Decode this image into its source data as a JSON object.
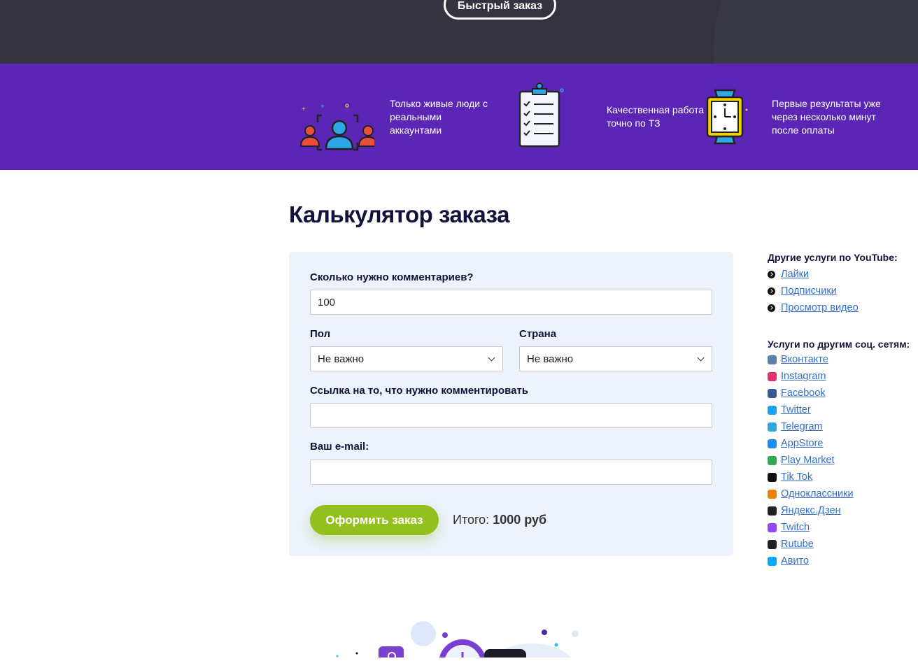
{
  "hero": {
    "quick_order_label": "Быстрый заказ"
  },
  "features": [
    {
      "icon": "people-icon",
      "text": "Только живые люди с реальными аккаунтами"
    },
    {
      "icon": "checklist-icon",
      "text": "Качественная работа точно по ТЗ"
    },
    {
      "icon": "watch-icon",
      "text": "Первые результаты уже через несколько минут после оплаты"
    }
  ],
  "calculator": {
    "title": "Калькулятор заказа",
    "count_label": "Сколько нужно комментариев?",
    "count_value": "100",
    "gender_label": "Пол",
    "gender_value": "Не важно",
    "country_label": "Страна",
    "country_value": "Не важно",
    "link_label": "Ссылка на то, что нужно комментировать",
    "link_value": "",
    "email_label": "Ваш e-mail:",
    "email_value": "",
    "order_button": "Оформить заказ",
    "total_label": "Итого:",
    "total_value": "1000 руб"
  },
  "sidebar": {
    "youtube_heading": "Другие услуги по YouTube:",
    "youtube_items": [
      "Лайки",
      "Подписчики",
      "Просмотр видео"
    ],
    "social_heading": "Услуги по другим соц. сетям:",
    "social_items": [
      {
        "label": "Вконтакте",
        "icon": "vk-icon",
        "color": "#5b7fa6"
      },
      {
        "label": "Instagram",
        "icon": "instagram-icon",
        "color": "#e1306c"
      },
      {
        "label": "Facebook",
        "icon": "facebook-icon",
        "color": "#3b5998"
      },
      {
        "label": "Twitter",
        "icon": "twitter-icon",
        "color": "#1da1f2"
      },
      {
        "label": "Telegram",
        "icon": "telegram-icon",
        "color": "#2ca5e0"
      },
      {
        "label": "AppStore",
        "icon": "appstore-icon",
        "color": "#1d8cf0"
      },
      {
        "label": "Play Market",
        "icon": "playmarket-icon",
        "color": "#34a853"
      },
      {
        "label": "Tik Tok",
        "icon": "tiktok-icon",
        "color": "#111111"
      },
      {
        "label": "Одноклассники",
        "icon": "ok-icon",
        "color": "#ee8208"
      },
      {
        "label": "Яндекс.Дзен",
        "icon": "zen-icon",
        "color": "#222222"
      },
      {
        "label": "Twitch",
        "icon": "twitch-icon",
        "color": "#9146ff"
      },
      {
        "label": "Rutube",
        "icon": "rutube-icon",
        "color": "#222222"
      },
      {
        "label": "Авито",
        "icon": "avito-icon",
        "color": "#00aaff"
      }
    ]
  },
  "colors": {
    "hero_bg": "#34333f",
    "features_bg": "#5b25b5",
    "accent_green": "#93c01f",
    "link": "#3470c7"
  }
}
